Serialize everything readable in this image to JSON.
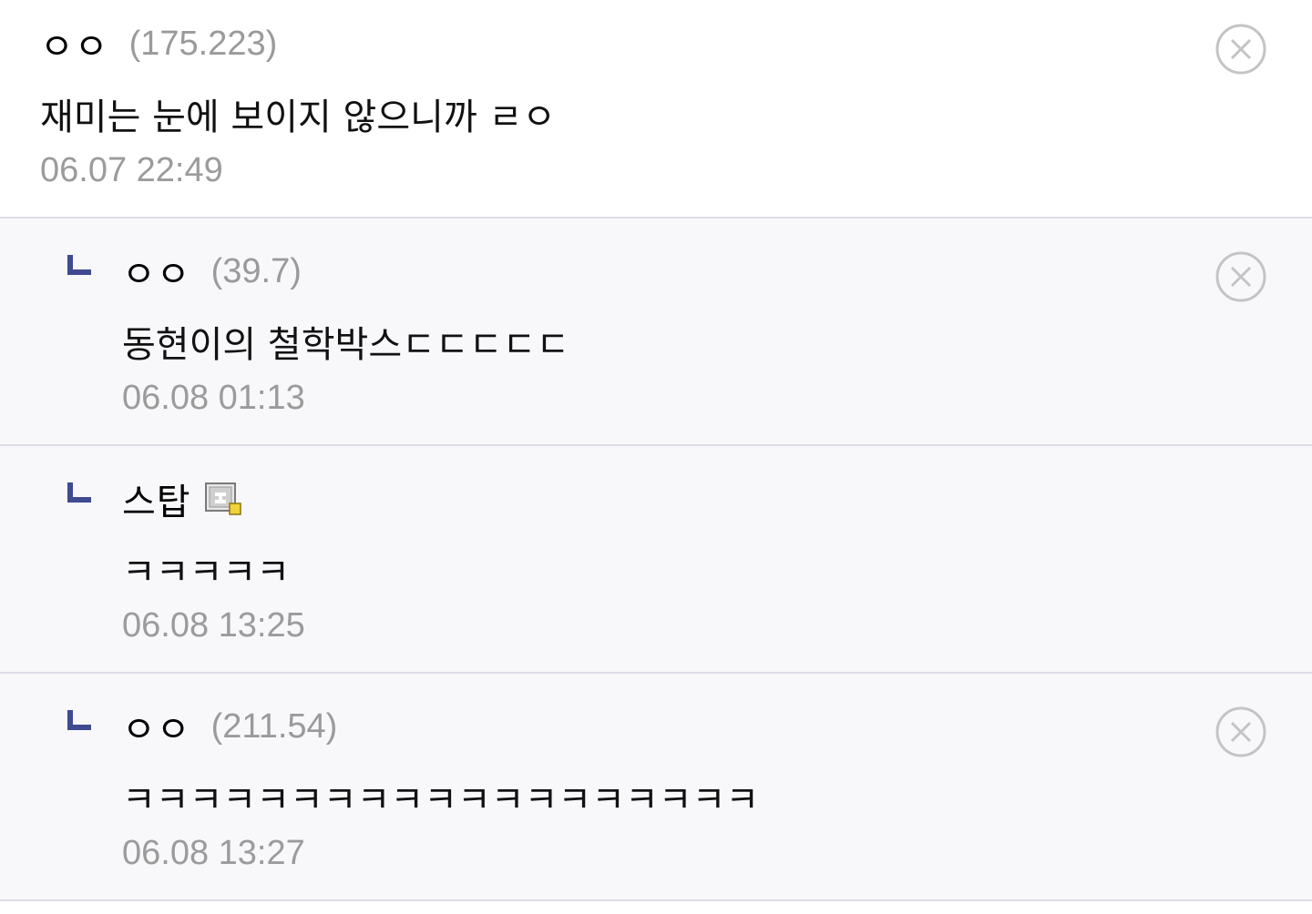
{
  "comments": [
    {
      "nick": "ㅇㅇ",
      "ip": "(175.223)",
      "text": "재미는 눈에 보이지 않으니까 ㄹㅇ",
      "time": "06.07 22:49",
      "is_reply": false,
      "delete_icon": "close-circle-icon"
    },
    {
      "nick": "ㅇㅇ",
      "ip": "(39.7)",
      "text": "동현이의 철학박스ㄷㄷㄷㄷㄷ",
      "time": "06.08 01:13",
      "is_reply": true,
      "reply_icon": "reply-arrow-icon",
      "delete_icon": "close-circle-icon"
    },
    {
      "nick": "스탑",
      "text": "ㅋㅋㅋㅋㅋ",
      "time": "06.08 13:25",
      "is_reply": true,
      "reply_icon": "reply-arrow-icon",
      "badge_icon": "gallog-fixed-nick-icon"
    },
    {
      "nick": "ㅇㅇ",
      "ip": "(211.54)",
      "text": "ㅋㅋㅋㅋㅋㅋㅋㅋㅋㅋㅋㅋㅋㅋㅋㅋㅋㅋㅋ",
      "time": "06.08 13:27",
      "is_reply": true,
      "reply_icon": "reply-arrow-icon",
      "delete_icon": "close-circle-icon"
    }
  ],
  "colors": {
    "reply_marker": "#3f4a8f",
    "ip_text": "#9a9a9a",
    "time_text": "#9b9b9b",
    "reply_bg": "#f8f8fb",
    "divider": "#dcdde6",
    "delete_icon": "#c4c4c4"
  }
}
